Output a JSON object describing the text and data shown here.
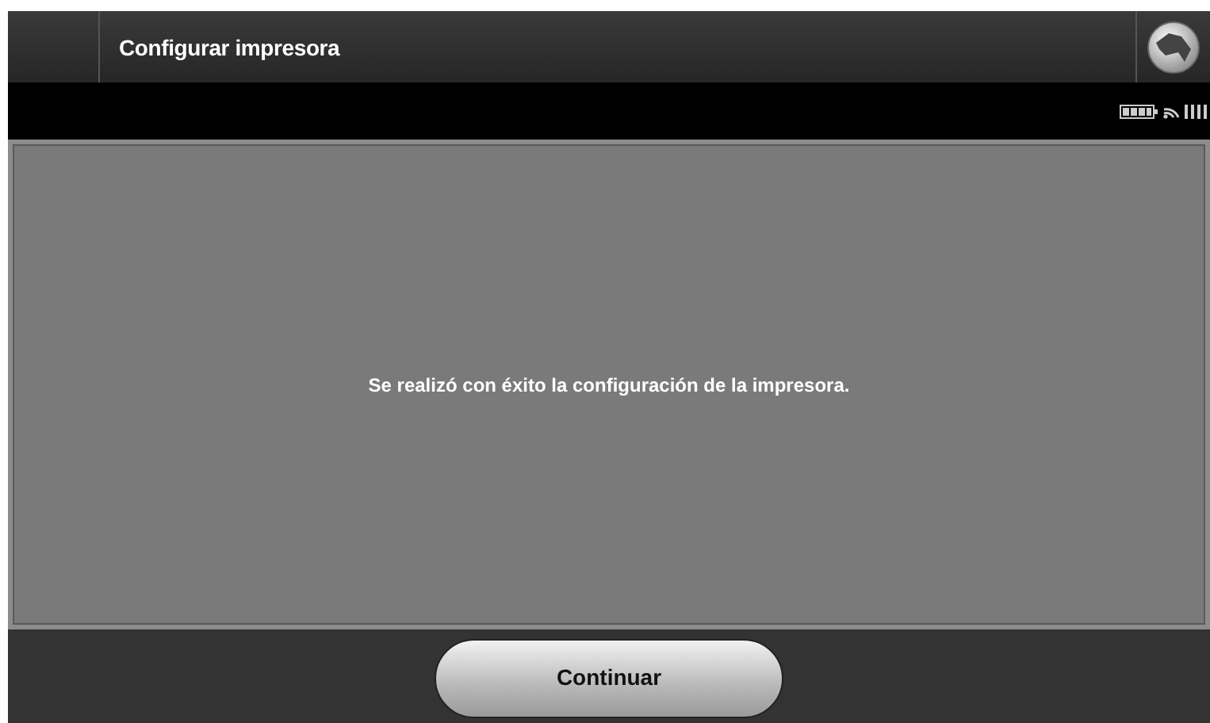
{
  "header": {
    "title": "Configurar impresora"
  },
  "message": "Se realizó con éxito la configuración de la impresora.",
  "buttons": [
    "Continuar"
  ]
}
